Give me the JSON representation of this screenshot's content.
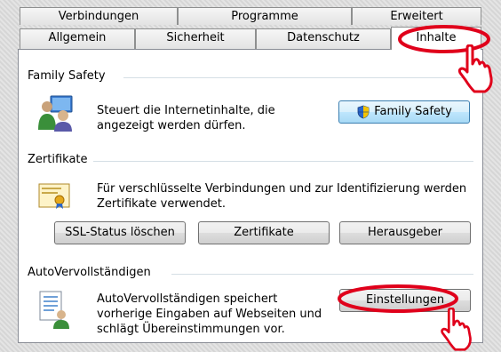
{
  "tabs_row1": [
    {
      "label": "Verbindungen"
    },
    {
      "label": "Programme"
    },
    {
      "label": "Erweitert"
    }
  ],
  "tabs_row2": [
    {
      "label": "Allgemein"
    },
    {
      "label": "Sicherheit"
    },
    {
      "label": "Datenschutz"
    },
    {
      "label": "Inhalte",
      "active": true
    }
  ],
  "family_safety": {
    "title": "Family Safety",
    "description": "Steuert die Internetinhalte, die\nangezeigt werden dürfen.",
    "button_label": "Family Safety"
  },
  "certificates": {
    "title": "Zertifikate",
    "description": "Für verschlüsselte Verbindungen und zur Identifizierung werden\nZertifikate verwendet.",
    "ssl_button": "SSL-Status löschen",
    "certs_button": "Zertifikate",
    "publisher_button": "Herausgeber"
  },
  "autocomplete": {
    "title": "AutoVervollständigen",
    "description": "AutoVervollständigen speichert\nvorherige Eingaben auf Webseiten und\nschlägt Übereinstimmungen vor.",
    "settings_button": "Einstellungen"
  },
  "colors": {
    "highlight_circle": "#e0001b",
    "button_focus": "#3c7fb1"
  }
}
